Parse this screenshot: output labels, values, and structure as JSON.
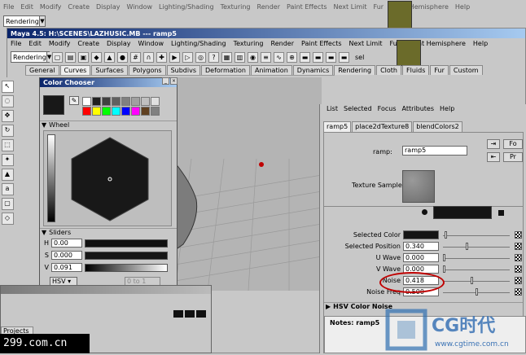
{
  "bg_menu": [
    "File",
    "Edit",
    "Modify",
    "Create",
    "Display",
    "Window",
    "Lighting/Shading",
    "Texturing",
    "Render",
    "Paint Effects",
    "Next Limit",
    "Fur",
    "Right Hemisphere",
    "Help"
  ],
  "bg_mode": "Rendering",
  "window_title": "Maya 4.5: H:\\SCENES\\LAZHUSIC.MB  ---  ramp5",
  "menu": [
    "File",
    "Edit",
    "Modify",
    "Create",
    "Display",
    "Window",
    "Lighting/Shading",
    "Texturing",
    "Render",
    "Paint Effects",
    "Next Limit",
    "Fur",
    "Right Hemisphere",
    "Help"
  ],
  "mode": "Rendering",
  "shelf_tabs": [
    "General",
    "Curves",
    "Surfaces",
    "Polygons",
    "Subdivs",
    "Deformation",
    "Animation",
    "Dynamics",
    "Rendering",
    "Cloth",
    "Fluids",
    "Fur",
    "Custom"
  ],
  "sel_label": "sel",
  "color_chooser": {
    "title": "Color Chooser",
    "wheel_label": "Wheel",
    "sliders_label": "Sliders",
    "H": "0.00",
    "S": "0.000",
    "V": "0.091",
    "mode": "HSV",
    "range": "0 to 1",
    "palette": [
      "#ffffff",
      "#202020",
      "#404040",
      "#606060",
      "#808080",
      "#a0a0a0",
      "#c0c0c0",
      "#e0e0e0",
      "#ff0000",
      "#ffff00",
      "#00ff00",
      "#00ffff",
      "#0000ff",
      "#ff00ff",
      "#604020",
      "#808080"
    ]
  },
  "attr": {
    "menu": [
      "List",
      "Selected",
      "Focus",
      "Attributes",
      "Help"
    ],
    "tabs": [
      "ramp5",
      "place2dTexture8",
      "blendColors2"
    ],
    "ramp_label": "ramp:",
    "ramp_value": "ramp5",
    "btn1": "Fo",
    "btn2": "Pr",
    "texture_sample": "Texture Sample",
    "rows": [
      {
        "label": "Selected Color",
        "value": ""
      },
      {
        "label": "Selected Position",
        "value": "0.340"
      },
      {
        "label": "U Wave",
        "value": "0.000"
      },
      {
        "label": "V Wave",
        "value": "0.000"
      },
      {
        "label": "Noise",
        "value": "0.418"
      },
      {
        "label": "Noise Freq",
        "value": "0.500"
      }
    ],
    "hsv_section": "HSV Color Noise",
    "notes": "Notes: ramp5"
  },
  "bottom": {
    "tab": "Projects"
  },
  "site": "299.com.cn",
  "watermark": {
    "brand": "CG时代",
    "url": "www.cgtime.com.cn"
  }
}
